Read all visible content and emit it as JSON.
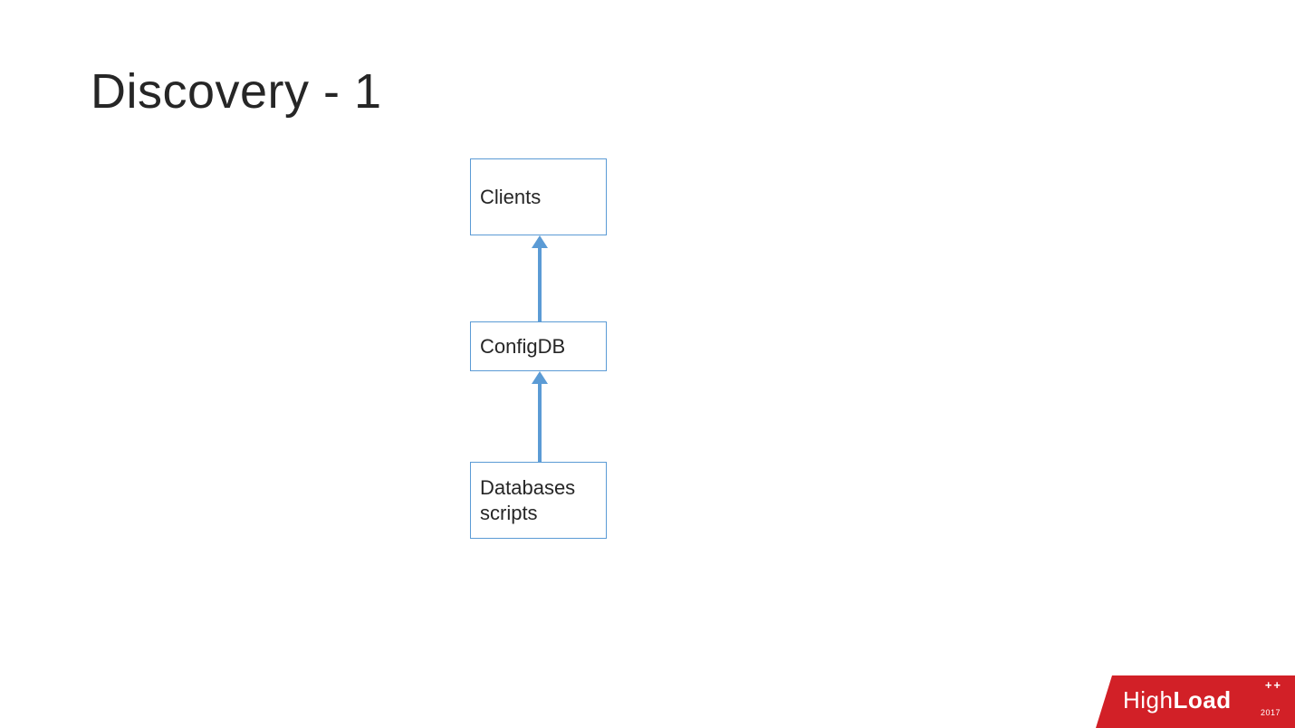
{
  "title": "Discovery - 1",
  "diagram": {
    "nodes": {
      "clients": "Clients",
      "configdb": "ConfigDB",
      "databases": "Databases scripts"
    },
    "arrows": [
      {
        "from": "configdb",
        "to": "clients"
      },
      {
        "from": "databases",
        "to": "configdb"
      }
    ],
    "style": {
      "border_color": "#5b9bd5",
      "arrow_color": "#5b9bd5"
    }
  },
  "logo": {
    "brand_light": "High",
    "brand_bold": "Load",
    "plus": "++",
    "year": "2017",
    "bg_color": "#d22027"
  }
}
